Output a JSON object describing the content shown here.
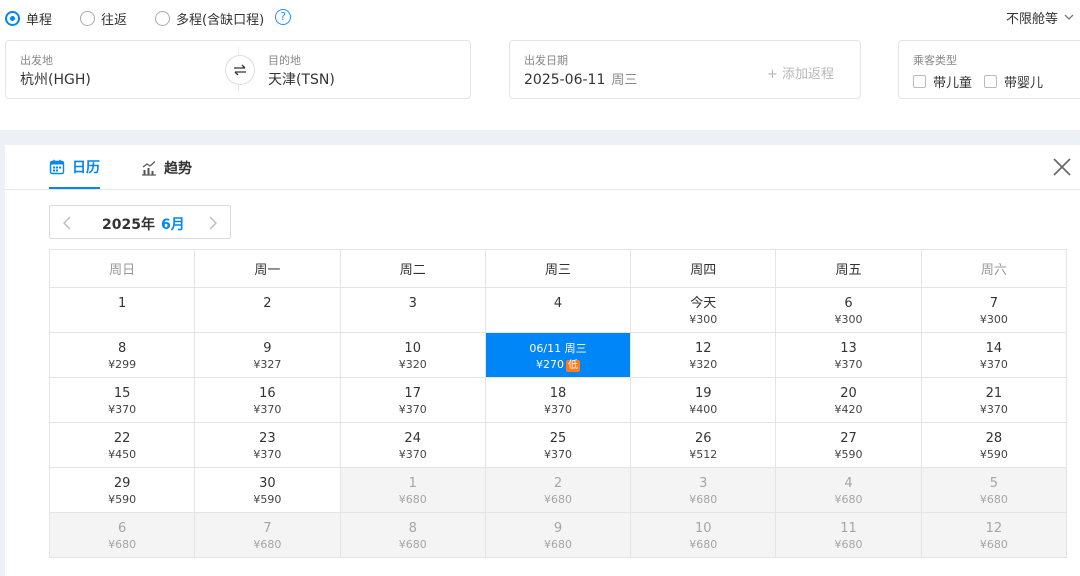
{
  "trip_types": [
    {
      "label": "单程",
      "checked": true
    },
    {
      "label": "往返",
      "checked": false
    },
    {
      "label": "多程(含缺口程)",
      "checked": false
    }
  ],
  "help_icon": "?",
  "cabin_label": "不限舱等",
  "route": {
    "from_label": "出发地",
    "from_value": "杭州(HGH)",
    "to_label": "目的地",
    "to_value": "天津(TSN)"
  },
  "date_field": {
    "label": "出发日期",
    "value": "2025-06-11",
    "weekday": "周三",
    "add_return": "+ 添加返程"
  },
  "passenger": {
    "label": "乘客类型",
    "options": [
      "带儿童",
      "带婴儿"
    ]
  },
  "tabs": [
    {
      "label": "日历",
      "active": true
    },
    {
      "label": "趋势",
      "active": false
    }
  ],
  "month_nav": {
    "year": "2025年",
    "month": "6月"
  },
  "weekdays": [
    "周日",
    "周一",
    "周二",
    "周三",
    "周四",
    "周五",
    "周六"
  ],
  "weeks": [
    [
      {
        "day": "1",
        "price": ""
      },
      {
        "day": "2",
        "price": ""
      },
      {
        "day": "3",
        "price": ""
      },
      {
        "day": "4",
        "price": ""
      },
      {
        "day": "今天",
        "price": "¥300"
      },
      {
        "day": "6",
        "price": "¥300"
      },
      {
        "day": "7",
        "price": "¥300"
      }
    ],
    [
      {
        "day": "8",
        "price": "¥299"
      },
      {
        "day": "9",
        "price": "¥327"
      },
      {
        "day": "10",
        "price": "¥320"
      },
      {
        "day": "06/11 周三",
        "price": "¥270",
        "selected": true,
        "badge": "低"
      },
      {
        "day": "12",
        "price": "¥320"
      },
      {
        "day": "13",
        "price": "¥370"
      },
      {
        "day": "14",
        "price": "¥370"
      }
    ],
    [
      {
        "day": "15",
        "price": "¥370"
      },
      {
        "day": "16",
        "price": "¥370"
      },
      {
        "day": "17",
        "price": "¥370"
      },
      {
        "day": "18",
        "price": "¥370"
      },
      {
        "day": "19",
        "price": "¥400"
      },
      {
        "day": "20",
        "price": "¥420"
      },
      {
        "day": "21",
        "price": "¥370"
      }
    ],
    [
      {
        "day": "22",
        "price": "¥450"
      },
      {
        "day": "23",
        "price": "¥370"
      },
      {
        "day": "24",
        "price": "¥370"
      },
      {
        "day": "25",
        "price": "¥370"
      },
      {
        "day": "26",
        "price": "¥512"
      },
      {
        "day": "27",
        "price": "¥590"
      },
      {
        "day": "28",
        "price": "¥590"
      }
    ],
    [
      {
        "day": "29",
        "price": "¥590"
      },
      {
        "day": "30",
        "price": "¥590"
      },
      {
        "day": "1",
        "price": "¥680",
        "other": true
      },
      {
        "day": "2",
        "price": "¥680",
        "other": true
      },
      {
        "day": "3",
        "price": "¥680",
        "other": true
      },
      {
        "day": "4",
        "price": "¥680",
        "other": true
      },
      {
        "day": "5",
        "price": "¥680",
        "other": true
      }
    ],
    [
      {
        "day": "6",
        "price": "¥680",
        "other": true
      },
      {
        "day": "7",
        "price": "¥680",
        "other": true
      },
      {
        "day": "8",
        "price": "¥680",
        "other": true
      },
      {
        "day": "9",
        "price": "¥680",
        "other": true
      },
      {
        "day": "10",
        "price": "¥680",
        "other": true
      },
      {
        "day": "11",
        "price": "¥680",
        "other": true
      },
      {
        "day": "12",
        "price": "¥680",
        "other": true
      }
    ]
  ],
  "colors": {
    "accent": "#0086f6",
    "low_badge": "#ff7a1a",
    "band": "#edf0f5"
  }
}
